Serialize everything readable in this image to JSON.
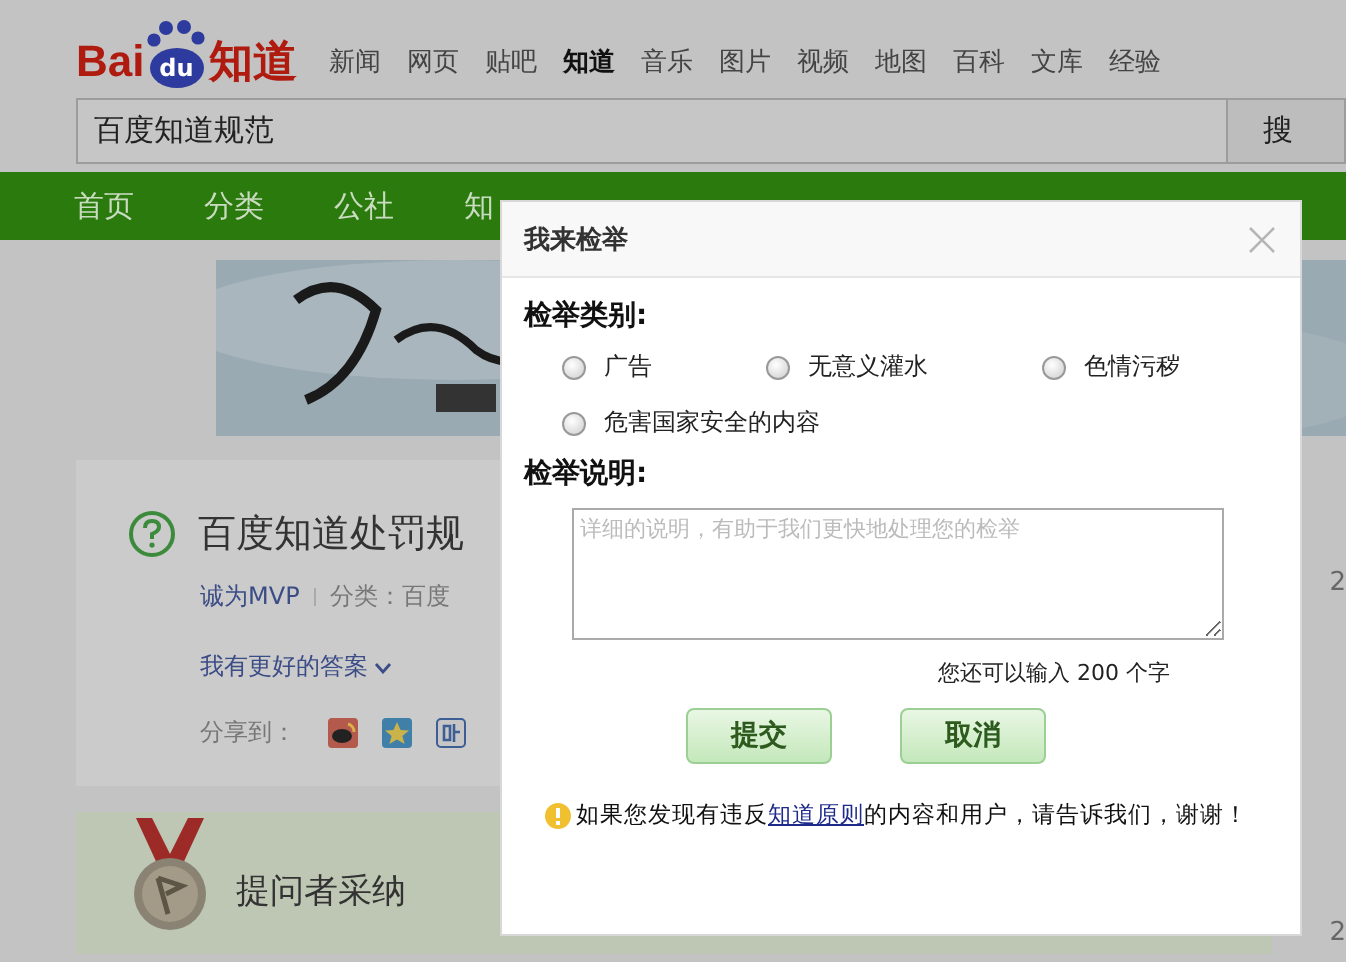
{
  "header": {
    "logo": {
      "left": "Bai",
      "badge": "du",
      "right": "知道"
    },
    "nav": [
      {
        "label": "新闻",
        "selected": false
      },
      {
        "label": "网页",
        "selected": false
      },
      {
        "label": "贴吧",
        "selected": false
      },
      {
        "label": "知道",
        "selected": true
      },
      {
        "label": "音乐",
        "selected": false
      },
      {
        "label": "图片",
        "selected": false
      },
      {
        "label": "视频",
        "selected": false
      },
      {
        "label": "地图",
        "selected": false
      },
      {
        "label": "百科",
        "selected": false
      },
      {
        "label": "文库",
        "selected": false
      },
      {
        "label": "经验",
        "selected": false
      }
    ],
    "search": {
      "value": "百度知道规范",
      "button": "搜"
    }
  },
  "menu": [
    {
      "label": "首页"
    },
    {
      "label": "分类"
    },
    {
      "label": "公社"
    },
    {
      "label": "知"
    }
  ],
  "question": {
    "title": "百度知道处罚规",
    "author": "诚为MVP",
    "category": "分类：百度",
    "better_answer": "我有更好的答案",
    "share_label": "分享到：",
    "date": "2"
  },
  "accepted": {
    "label": "提问者采纳",
    "date": "2"
  },
  "dialog": {
    "title": "我来检举",
    "category_label": "检举类别:",
    "options": [
      {
        "label": "广告",
        "selected": false
      },
      {
        "label": "无意义灌水",
        "selected": false
      },
      {
        "label": "色情污秽",
        "selected": false
      },
      {
        "label": "危害国家安全的内容",
        "selected": false
      }
    ],
    "description_label": "检举说明:",
    "placeholder": "详细的说明，有助于我们更快地处理您的检举",
    "counter": {
      "before": "您还可以输入",
      "count": "200",
      "after": "个字"
    },
    "buttons": [
      "提交",
      "取消"
    ],
    "notice": {
      "before": "如果您发现有违反",
      "link": "知道原则",
      "after": "的内容和用户，请告诉我们，谢谢！"
    }
  }
}
